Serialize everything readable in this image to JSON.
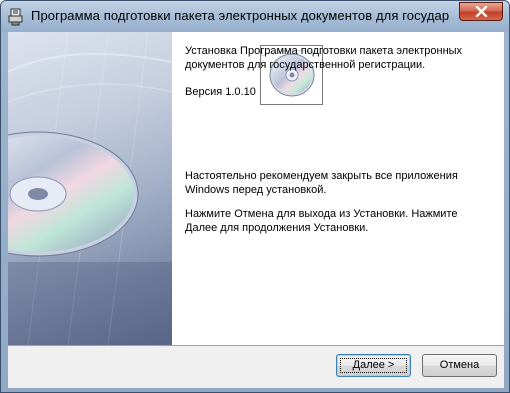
{
  "window": {
    "title": "Программа подготовки пакета электронных документов для государствен..."
  },
  "content": {
    "heading": "Установка Программа подготовки пакета электронных документов для государственной регистрации.",
    "version": "Версия 1.0.10",
    "recommendation": "Настоятельно рекомендуем закрыть все приложения Windows перед установкой.",
    "instructions": "Нажмите Отмена для выхода из Установки.  Нажмите Далее для продолжения Установки."
  },
  "buttons": {
    "next_label": "Далее >",
    "cancel_label": "Отмена"
  },
  "icons": {
    "app": "installer-icon",
    "close": "close-icon",
    "cd": "cd-disc-icon"
  },
  "colors": {
    "close_button": "#c7452e",
    "side_panel": "#8d9ab5",
    "titlebar": "#a9bfd8"
  }
}
